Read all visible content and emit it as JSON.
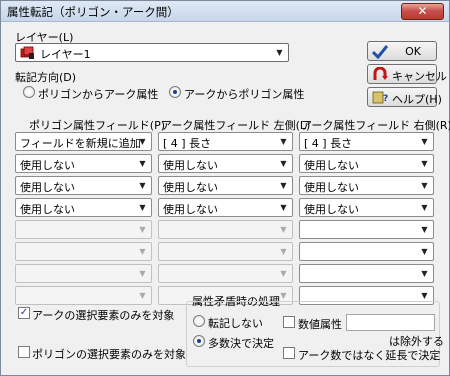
{
  "window": {
    "title": "属性転記（ポリゴン・アーク間）",
    "close_label": "✕"
  },
  "layer": {
    "label": "レイヤー(L)",
    "value": "レイヤー1"
  },
  "direction": {
    "label": "転記方向(D)",
    "options": [
      "ポリゴンからアーク属性",
      "アークからポリゴン属性"
    ],
    "selected": 1
  },
  "buttons": {
    "ok": "OK",
    "cancel": "キャンセル",
    "help": "ヘルプ(H)"
  },
  "columns": {
    "polygon": {
      "header": "ポリゴン属性フィールド(P)",
      "rows": [
        "フィールドを新規に追加",
        "使用しない",
        "使用しない",
        "使用しない",
        "",
        "",
        "",
        ""
      ]
    },
    "arc_left": {
      "header": "アーク属性フィールド 左側(L)",
      "rows": [
        "[ 4 ] 長さ",
        "使用しない",
        "使用しない",
        "使用しない",
        "",
        "",
        "",
        ""
      ]
    },
    "arc_right": {
      "header": "アーク属性フィールド 右側(R)",
      "rows": [
        "[ 4 ] 長さ",
        "使用しない",
        "使用しない",
        "使用しない",
        "",
        "",
        "",
        ""
      ]
    }
  },
  "options": {
    "arc_selected_only": {
      "label": "アークの選択要素のみを対象",
      "checked": true
    },
    "polygon_selected_only": {
      "label": "ポリゴンの選択要素のみを対象",
      "checked": false
    }
  },
  "conflict": {
    "title": "属性矛盾時の処理",
    "no_transfer": "転記しない",
    "majority": "多数決で決定",
    "selected": 1,
    "numeric_label": "数値属性",
    "numeric_value": "",
    "exclude_note": "は除外する",
    "by_length_label": "アーク数ではなく延長で決定"
  },
  "colors": {
    "title_bg": "#c6d6ea",
    "close_red": "#c75050",
    "accent": "#1a3f8c"
  },
  "icons": {
    "ok": "checkmark-icon",
    "cancel": "cancel-arrow-icon",
    "help": "help-icon",
    "layer": "layer-icon"
  }
}
